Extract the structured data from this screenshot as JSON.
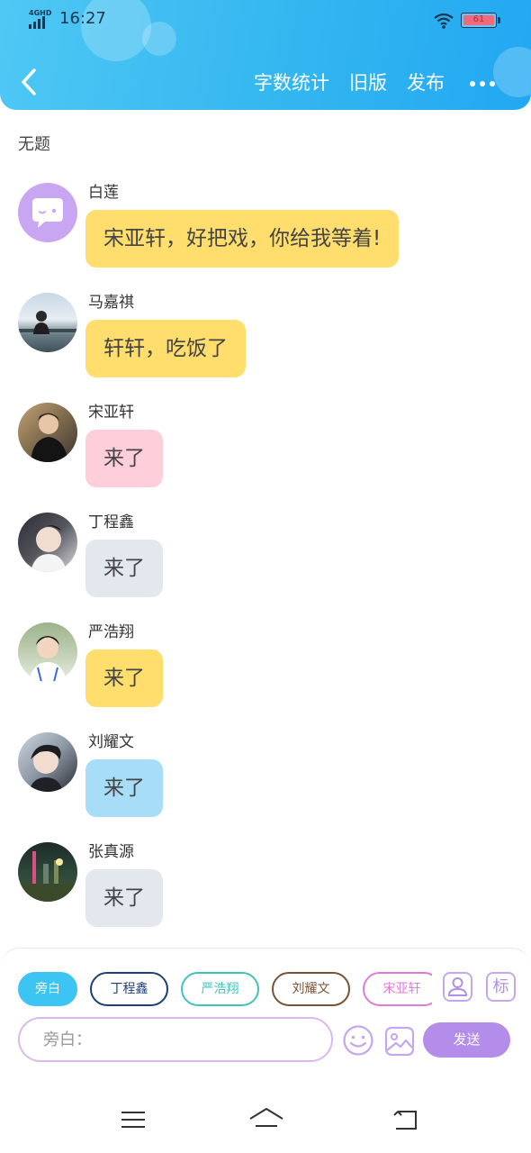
{
  "status_bar": {
    "network": "4GHD",
    "time": "16:27",
    "battery": "61"
  },
  "header": {
    "actions": [
      "字数统计",
      "旧版",
      "发布"
    ]
  },
  "doc_title": "无题",
  "messages": [
    {
      "sender": "白莲",
      "text": "宋亚轩，好把戏，你给我等着!",
      "bubble_color": "#ffde6e",
      "avatar": "chat-icon"
    },
    {
      "sender": "马嘉祺",
      "text": "轩轩，吃饭了",
      "bubble_color": "#ffde6e",
      "avatar": "photo-avatar"
    },
    {
      "sender": "宋亚轩",
      "text": "来了",
      "bubble_color": "#ffcedb",
      "avatar": "photo-avatar"
    },
    {
      "sender": "丁程鑫",
      "text": "来了",
      "bubble_color": "#e3e8ef",
      "avatar": "photo-avatar"
    },
    {
      "sender": "严浩翔",
      "text": "来了",
      "bubble_color": "#ffde6e",
      "avatar": "photo-avatar"
    },
    {
      "sender": "刘耀文",
      "text": "来了",
      "bubble_color": "#a8ddf8",
      "avatar": "photo-avatar"
    },
    {
      "sender": "张真源",
      "text": "来了",
      "bubble_color": "#e3e8ef",
      "avatar": "photo-avatar"
    }
  ],
  "composer": {
    "roles": [
      {
        "label": "旁白",
        "color": "#3cc4f2",
        "active": true
      },
      {
        "label": "丁程鑫",
        "color": "#1c3f7a",
        "active": false
      },
      {
        "label": "严浩翔",
        "color": "#3fc4bc",
        "active": false
      },
      {
        "label": "刘耀文",
        "color": "#7a5234",
        "active": false
      },
      {
        "label": "宋亚轩",
        "color": "#e07ad8",
        "active": false
      }
    ],
    "tag_label": "标",
    "input_placeholder": "旁白：",
    "send_label": "发送"
  },
  "colors": {
    "header": "#33b6f0",
    "accent": "#b48deb"
  }
}
